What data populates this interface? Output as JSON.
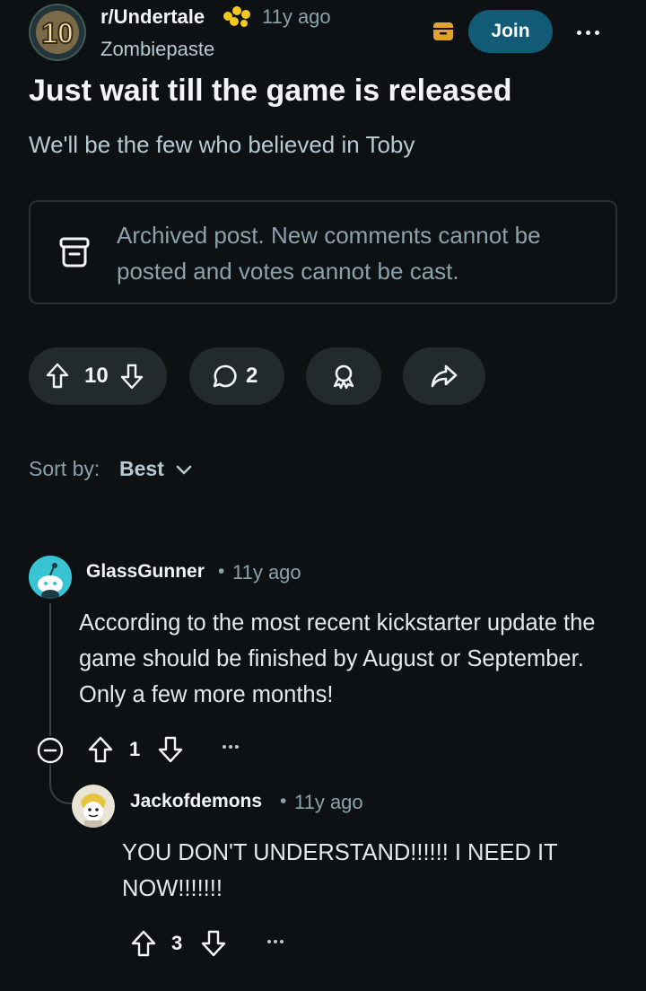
{
  "post": {
    "subreddit": "r/Undertale",
    "time": "11y ago",
    "author": "Zombiepaste",
    "join_label": "Join",
    "title": "Just wait till the game is released",
    "body": "We'll be the few who believed in Toby",
    "archive_notice": "Archived post. New comments cannot be posted and votes cannot be cast.",
    "votes": "10",
    "comments": "2",
    "badge_number": "10"
  },
  "sort": {
    "label": "Sort by:",
    "value": "Best"
  },
  "comments": [
    {
      "user": "GlassGunner",
      "separator": "•",
      "time": "11y ago",
      "body": "According to the most recent kickstarter update the game should be finished by August or September. Only a few more months!",
      "votes": "1"
    },
    {
      "user": "Jackofdemons",
      "separator": "•",
      "time": "11y ago",
      "body": "YOU DON'T UNDERSTAND!!!!!! I NEED IT NOW!!!!!!!",
      "votes": "3"
    }
  ],
  "colors": {
    "background": "#0e1113",
    "join": "#115b77",
    "pill": "#232a2e",
    "archive_icon": "#e0a42a",
    "flair": "#f2c91d",
    "avatar1": "#38c4d2"
  },
  "icons": [
    "subreddit-avatar",
    "flair-icon",
    "archive-icon",
    "more-icon",
    "upvote-icon",
    "downvote-icon",
    "comment-icon",
    "award-icon",
    "share-icon",
    "chevron-down-icon",
    "collapse-icon",
    "avatar"
  ]
}
